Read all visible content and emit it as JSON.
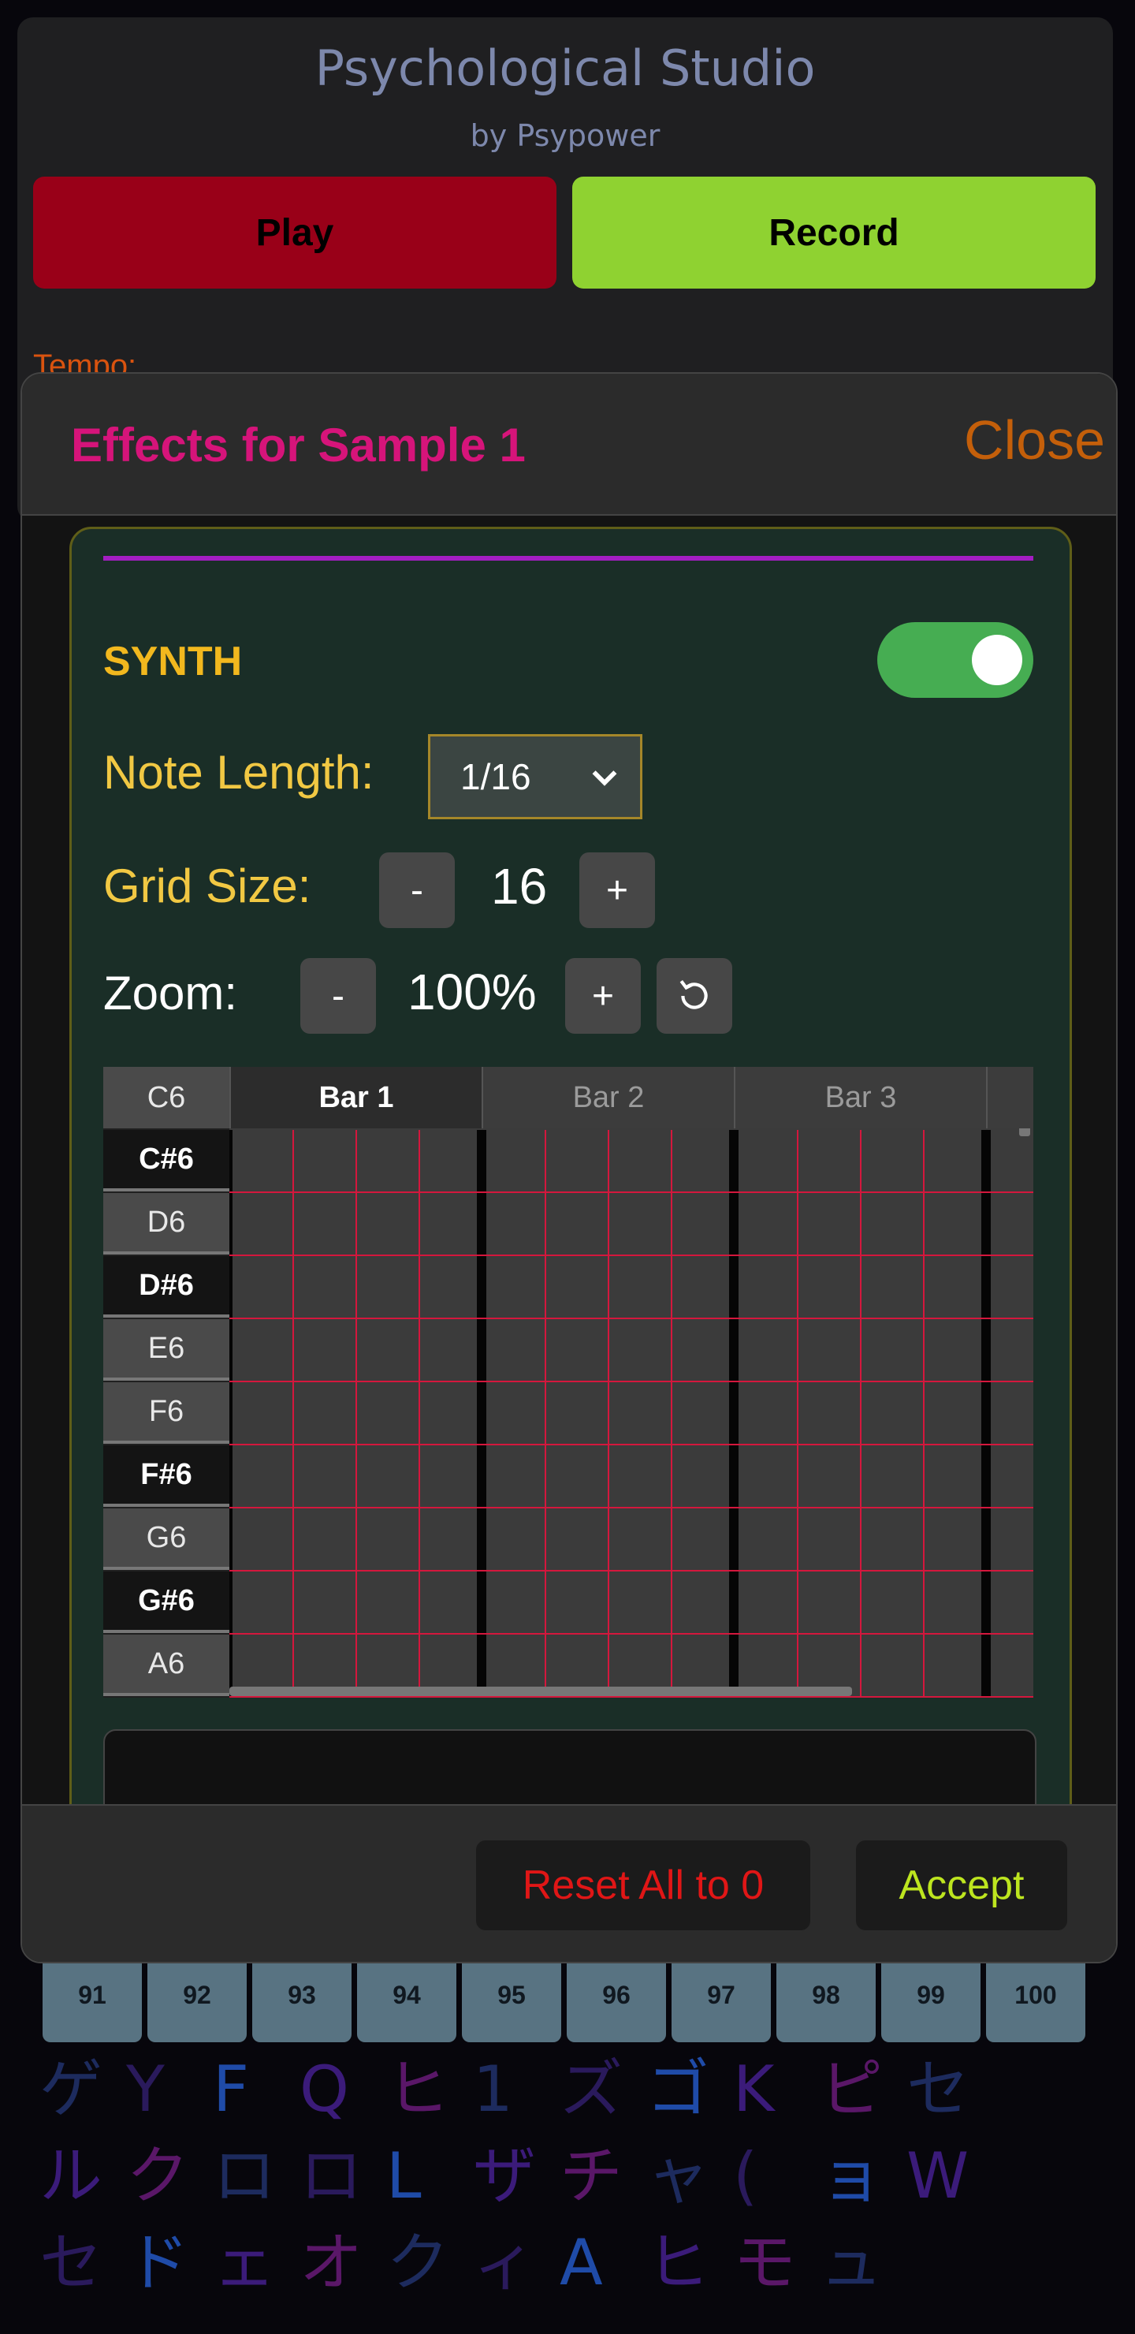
{
  "app": {
    "title": "Psychological Studio",
    "subtitle": "by Psypower",
    "play_label": "Play",
    "record_label": "Record",
    "tempo_label": "Tempo:"
  },
  "modal": {
    "title": "Effects for Sample 1",
    "close_label": "Close",
    "synth": {
      "label": "SYNTH",
      "enabled": true,
      "note_length_label": "Note Length:",
      "note_length_value": "1/16",
      "grid_size_label": "Grid Size:",
      "grid_size_value": "16",
      "grid_minus": "-",
      "grid_plus": "+",
      "zoom_label": "Zoom:",
      "zoom_value": "100%",
      "zoom_minus": "-",
      "zoom_plus": "+",
      "header_note": "C6",
      "bars": [
        {
          "label": "Bar 1",
          "active": true
        },
        {
          "label": "Bar 2",
          "active": false
        },
        {
          "label": "Bar 3",
          "active": false
        }
      ],
      "notes": [
        {
          "name": "C#6",
          "black": true
        },
        {
          "name": "D6",
          "black": false
        },
        {
          "name": "D#6",
          "black": true
        },
        {
          "name": "E6",
          "black": false
        },
        {
          "name": "F6",
          "black": false
        },
        {
          "name": "F#6",
          "black": true
        },
        {
          "name": "G6",
          "black": false
        },
        {
          "name": "G#6",
          "black": true
        },
        {
          "name": "A6",
          "black": false
        }
      ]
    },
    "reset_label": "Reset All to 0",
    "accept_label": "Accept"
  },
  "keypad": [
    "91",
    "92",
    "93",
    "94",
    "95",
    "96",
    "97",
    "98",
    "99",
    "100"
  ],
  "colors": {
    "play": "#990018",
    "record": "#8fd231",
    "modal_title": "#d6147a",
    "close": "#c45f0a",
    "synth_label": "#f2b81e",
    "toggle_on": "#46ad52",
    "grid_line": "#d4173d",
    "reset": "#e01616",
    "accept": "#bde51f"
  },
  "background_rain": [
    [
      "ゲ",
      "Y",
      "F",
      "Q",
      "ヒ",
      "1",
      "ズ",
      "ゴ",
      "K",
      "ピ",
      "セ"
    ],
    [
      "ル",
      "ク",
      "ロ",
      "ロ",
      "L",
      "ザ",
      "チ",
      "ャ",
      "(",
      "ョ",
      "W"
    ],
    [
      "セ",
      "ド",
      "ェ",
      "オ",
      "ク",
      "ィ",
      "A",
      "ヒ",
      "モ",
      "ュ"
    ]
  ]
}
